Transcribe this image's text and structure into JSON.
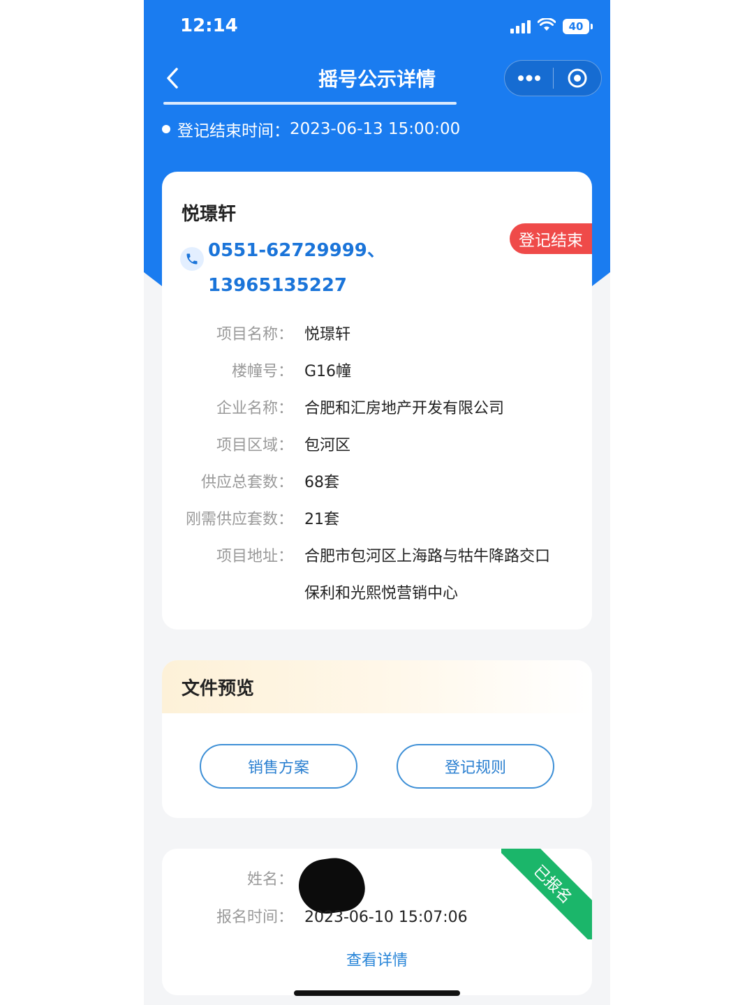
{
  "status_bar": {
    "time": "12:14",
    "battery": "40"
  },
  "nav": {
    "title": "摇号公示详情"
  },
  "registration": {
    "end_label": "登记结束时间：",
    "end_value": "2023-06-13 15:00:00"
  },
  "project": {
    "name": "悦璟轩",
    "phones": [
      "0551-62729999、",
      "13965135227"
    ],
    "status_tag": "登记结束",
    "details": [
      {
        "label": "项目名称：",
        "value": "悦璟轩"
      },
      {
        "label": "楼幢号：",
        "value": "G16幢"
      },
      {
        "label": "企业名称：",
        "value": "合肥和汇房地产开发有限公司"
      },
      {
        "label": "项目区域：",
        "value": "包河区"
      },
      {
        "label": "供应总套数：",
        "value": "68套"
      },
      {
        "label": "刚需供应套数：",
        "value": "21套"
      },
      {
        "label": "项目地址：",
        "value": "合肥市包河区上海路与牯牛降路交口",
        "value2": "保利和光熙悦营销中心"
      }
    ]
  },
  "files": {
    "title": "文件预览",
    "buttons": [
      "销售方案",
      "登记规则"
    ]
  },
  "signup": {
    "name_label": "姓名：",
    "time_label": "报名时间：",
    "time_value": "2023-06-10 15:07:06",
    "ribbon": "已报名",
    "detail_link": "查看详情"
  },
  "colors": {
    "brand_blue": "#1a7cf0",
    "tag_red": "#ef4a49",
    "ribbon_green": "#1bb66a",
    "link_blue": "#2a86d8"
  }
}
